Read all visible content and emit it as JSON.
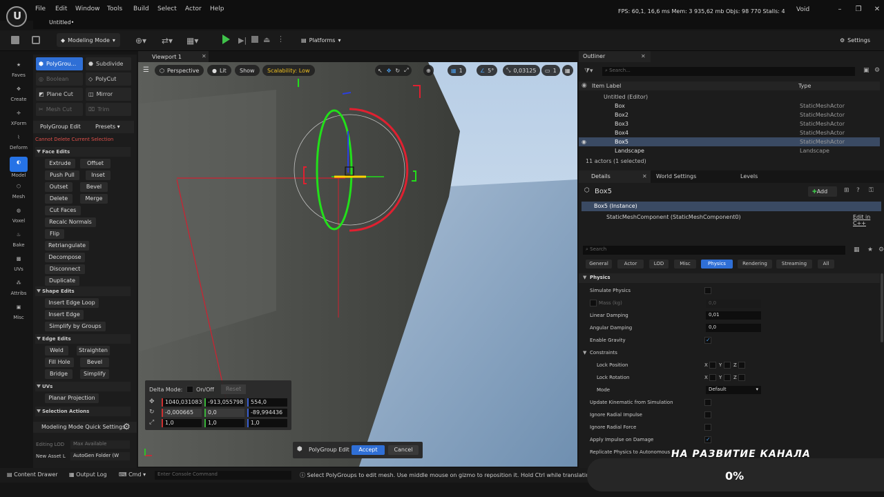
{
  "menu": [
    "File",
    "Edit",
    "Window",
    "Tools",
    "Build",
    "Select",
    "Actor",
    "Help"
  ],
  "stats": {
    "fps": "FPS: 60,1",
    "ms": "16,6 ms",
    "mem": "Mem: 3 935,62 mb",
    "objs": "Objs: 98 770",
    "stalls": "Stalls: 4"
  },
  "project_name": "Void",
  "document_tab": "Untitled•",
  "toolbar": {
    "mode": "Modeling Mode",
    "platforms": "Platforms",
    "settings": "Settings"
  },
  "modes": [
    "Faves",
    "Create",
    "XForm",
    "Deform",
    "Model",
    "Mesh",
    "Voxel",
    "Bake",
    "UVs",
    "Attribs",
    "Misc"
  ],
  "active_mode": "Model",
  "tools": {
    "polygroup": "PolyGrou...",
    "subdivide": "Subdivide",
    "boolean": "Boolean",
    "polycut": "PolyCut",
    "planecut": "Plane Cut",
    "mirror": "Mirror",
    "meshcut": "Mesh Cut",
    "trim": "Trim"
  },
  "panel": {
    "title": "PolyGroup Edit",
    "presets": "Presets",
    "warning": "Cannot Delete Current Selection",
    "face_edits": "Face Edits",
    "face_buttons": [
      "Extrude",
      "Offset",
      "Push Pull",
      "Inset",
      "Outset",
      "Bevel",
      "Delete",
      "Merge",
      "Cut Faces",
      "Recalc Normals",
      "Flip",
      "Retriangulate",
      "Decompose",
      "Disconnect",
      "Duplicate"
    ],
    "shape_edits": "Shape Edits",
    "shape_buttons": [
      "Insert Edge Loop",
      "Insert Edge",
      "Simplify by Groups"
    ],
    "edge_edits": "Edge Edits",
    "edge_buttons": [
      "Weld",
      "Straighten",
      "Fill Hole",
      "Bevel",
      "Bridge",
      "Simplify"
    ],
    "uvs": "UVs",
    "uv_buttons": [
      "Planar Projection"
    ],
    "selection_actions": "Selection Actions",
    "quick_settings": "Modeling Mode Quick Settings",
    "editing_lod_label": "Editing LOD",
    "editing_lod_value": "Max Available",
    "new_asset_label": "New Asset L",
    "new_asset_value": "AutoGen Folder (W"
  },
  "viewport": {
    "tab": "Viewport 1",
    "perspective": "Perspective",
    "lit": "Lit",
    "show": "Show",
    "scalability": "Scalability: Low",
    "grid": "1",
    "angle": "5°",
    "scale": "0,03125",
    "camera": "1"
  },
  "transform": {
    "delta_mode": "Delta Mode:",
    "onoff": "On/Off",
    "reset": "Reset",
    "location": [
      "1040,031083",
      "-913,055798",
      "554,0"
    ],
    "rotation": [
      "-0,000665",
      "0,0",
      "-89,994436"
    ],
    "scale": [
      "1,0",
      "1,0",
      "1,0"
    ]
  },
  "accept_bar": {
    "label": "PolyGroup Edit",
    "accept": "Accept",
    "cancel": "Cancel"
  },
  "outliner": {
    "tab": "Outliner",
    "search": "Search...",
    "col_label": "Item Label",
    "col_type": "Type",
    "root": "Untitled (Editor)",
    "items": [
      {
        "name": "Box",
        "type": "StaticMeshActor"
      },
      {
        "name": "Box2",
        "type": "StaticMeshActor"
      },
      {
        "name": "Box3",
        "type": "StaticMeshActor"
      },
      {
        "name": "Box4",
        "type": "StaticMeshActor"
      },
      {
        "name": "Box5",
        "type": "StaticMeshActor"
      },
      {
        "name": "Landscape",
        "type": "Landscape"
      }
    ],
    "selected": "Box5",
    "count": "11 actors (1 selected)"
  },
  "details": {
    "tabs": [
      "Details",
      "World Settings",
      "Levels"
    ],
    "actor": "Box5",
    "add": "Add",
    "instance": "Box5 (Instance)",
    "component": "StaticMeshComponent (StaticMeshComponent0)",
    "edit_cpp": "Edit in C++",
    "search": "Search",
    "filters": [
      "General",
      "Actor",
      "LOD",
      "Misc",
      "Physics",
      "Rendering",
      "Streaming",
      "All"
    ],
    "active_filter": "Physics",
    "physics_header": "Physics",
    "simulate": "Simulate Physics",
    "mass": "Mass (kg)",
    "mass_val": "0,0",
    "linear_damping": "Linear Damping",
    "linear_val": "0,01",
    "angular_damping": "Angular Damping",
    "angular_val": "0,0",
    "gravity": "Enable Gravity",
    "constraints": "Constraints",
    "lock_pos": "Lock Position",
    "lock_rot": "Lock Rotation",
    "axes": [
      "X",
      "Y",
      "Z"
    ],
    "mode": "Mode",
    "mode_val": "Default",
    "update_kinematic": "Update Kinematic from Simulation",
    "ignore_radial_impulse": "Ignore Radial Impulse",
    "ignore_radial_force": "Ignore Radial Force",
    "apply_impulse": "Apply Impulse on Damage",
    "replicate": "Replicate Physics to Autonomous P"
  },
  "statusbar": {
    "content_drawer": "Content Drawer",
    "output_log": "Output Log",
    "cmd": "Cmd",
    "console_placeholder": "Enter Console Command",
    "hint": "Select PolyGroups to edit mesh. Use middle mouse on gizmo to reposition it. Hold Ctrl while translating or (i"
  },
  "overlay": {
    "title": "НА РАЗВИТИЕ КАНАЛА",
    "percent": "0%"
  },
  "colors": {
    "accent": "#2f6fd6",
    "x_axis": "#e02030",
    "y_axis": "#22e01a",
    "z_axis": "#2b3fe0"
  }
}
